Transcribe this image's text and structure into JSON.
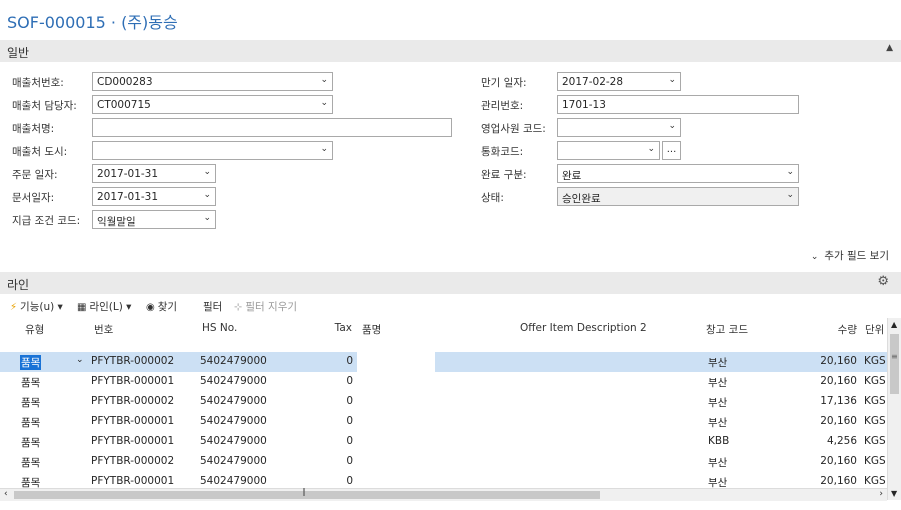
{
  "page": {
    "title": "SOF-000015 · (주)동승"
  },
  "general": {
    "section_title": "일반",
    "collapse_icon": "chevron-up",
    "left_fields": [
      {
        "label": "매출처번호:",
        "value": "CD000283",
        "type": "dropdown"
      },
      {
        "label": "매출처 담당자:",
        "value": "CT000715",
        "type": "dropdown"
      },
      {
        "label": "매출처명:",
        "value": "",
        "type": "text"
      },
      {
        "label": "매출처 도시:",
        "value": "",
        "type": "dropdown"
      },
      {
        "label": "주문 일자:",
        "value": "2017-01-31",
        "type": "dropdown"
      },
      {
        "label": "문서일자:",
        "value": "2017-01-31",
        "type": "dropdown"
      },
      {
        "label": "지급 조건 코드:",
        "value": "익월말일",
        "type": "dropdown"
      }
    ],
    "right_fields": [
      {
        "label": "만기 일자:",
        "value": "2017-02-28",
        "type": "dropdown"
      },
      {
        "label": "관리번호:",
        "value": "1701-13",
        "type": "text"
      },
      {
        "label": "영업사원 코드:",
        "value": "",
        "type": "dropdown"
      },
      {
        "label": "통화코드:",
        "value": "",
        "type": "dropdown-assist"
      },
      {
        "label": "완료 구분:",
        "value": "완료",
        "type": "dropdown"
      },
      {
        "label": "상태:",
        "value": "승인완료",
        "type": "dropdown-readonly"
      }
    ],
    "assist_button_label": "...",
    "show_more_label": "추가 필드 보기"
  },
  "lines": {
    "section_title": "라인",
    "toolbar": {
      "functions_label": "기능(u)",
      "line_label": "라인(L)",
      "find_label": "찾기",
      "filter_label": "필터",
      "clear_filter_label": "필터 지우기"
    },
    "columns": [
      "유형",
      "번호",
      "HS No.",
      "Tax",
      "품명",
      "Offer Item Description 2",
      "창고 코드",
      "수량",
      "단위"
    ],
    "rows": [
      {
        "type": "품목",
        "no": "PFYTBR-000002",
        "hs": "5402479000",
        "tax": "0",
        "location": "부산",
        "qty": "20,160",
        "unit": "KGS",
        "selected": true
      },
      {
        "type": "품목",
        "no": "PFYTBR-000001",
        "hs": "5402479000",
        "tax": "0",
        "location": "부산",
        "qty": "20,160",
        "unit": "KGS",
        "selected": false
      },
      {
        "type": "품목",
        "no": "PFYTBR-000002",
        "hs": "5402479000",
        "tax": "0",
        "location": "부산",
        "qty": "17,136",
        "unit": "KGS",
        "selected": false
      },
      {
        "type": "품목",
        "no": "PFYTBR-000001",
        "hs": "5402479000",
        "tax": "0",
        "location": "부산",
        "qty": "20,160",
        "unit": "KGS",
        "selected": false
      },
      {
        "type": "품목",
        "no": "PFYTBR-000001",
        "hs": "5402479000",
        "tax": "0",
        "location": "KBB",
        "qty": "4,256",
        "unit": "KGS",
        "selected": false
      },
      {
        "type": "품목",
        "no": "PFYTBR-000002",
        "hs": "5402479000",
        "tax": "0",
        "location": "부산",
        "qty": "20,160",
        "unit": "KGS",
        "selected": false
      },
      {
        "type": "품목",
        "no": "PFYTBR-000001",
        "hs": "5402479000",
        "tax": "0",
        "location": "부산",
        "qty": "20,160",
        "unit": "KGS",
        "selected": false
      }
    ]
  },
  "colors": {
    "title": "#2e6eb5",
    "header_bg": "#eaeaea",
    "selected_row": "#cce0f4",
    "selected_cell": "#1a73d6"
  }
}
